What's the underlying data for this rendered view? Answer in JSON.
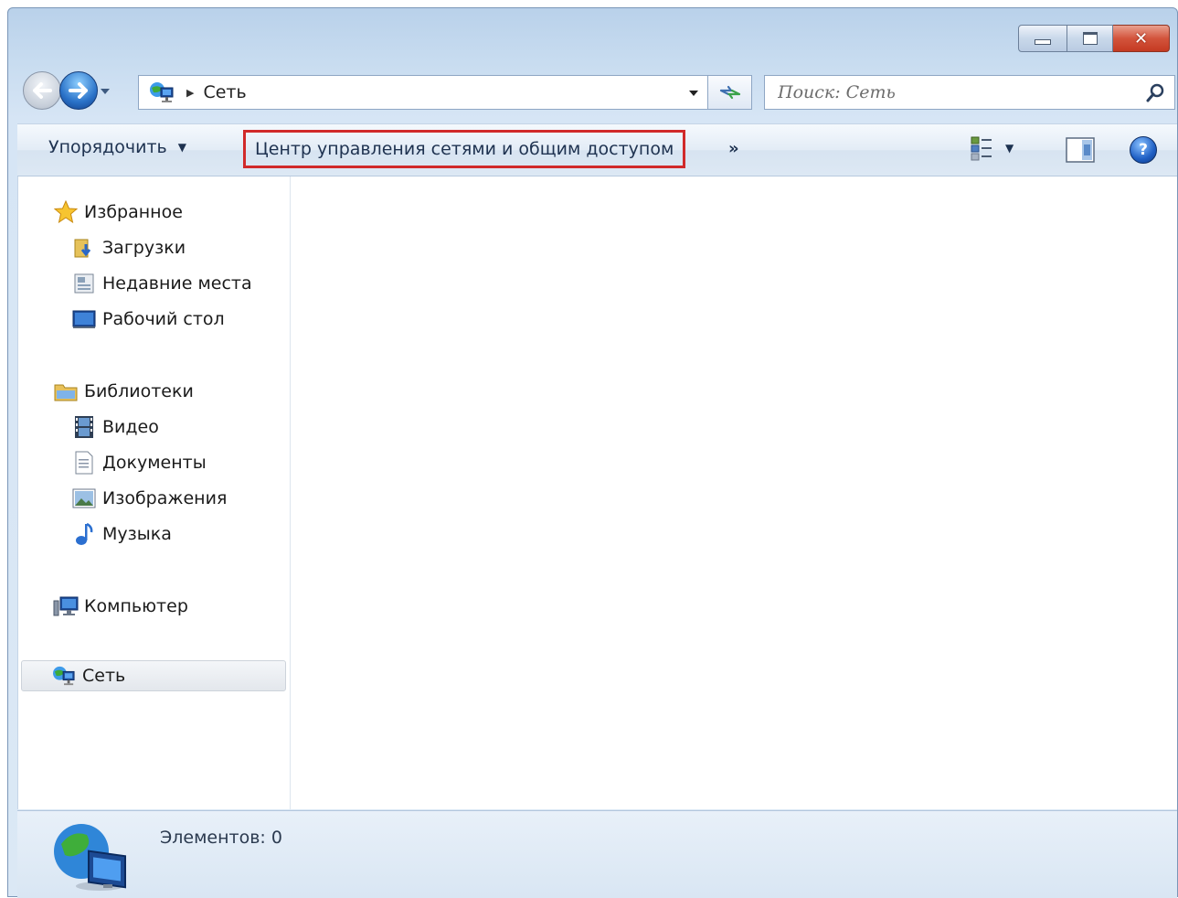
{
  "window": {
    "caption_buttons": [
      "minimize",
      "maximize",
      "close"
    ]
  },
  "address_bar": {
    "location_icon": "network-icon",
    "breadcrumb": [
      "Сеть"
    ]
  },
  "search": {
    "placeholder": "Поиск: Сеть"
  },
  "command_bar": {
    "organize_label": "Упорядочить",
    "network_center_label": "Центр управления сетями и общим доступом",
    "more_label": "»",
    "highlight_color": "#d12a2a"
  },
  "nav_pane": {
    "favorites": {
      "label": "Избранное",
      "items": [
        {
          "label": "Загрузки",
          "icon": "downloads-folder-icon"
        },
        {
          "label": "Недавние места",
          "icon": "recent-places-icon"
        },
        {
          "label": "Рабочий стол",
          "icon": "desktop-icon"
        }
      ]
    },
    "libraries": {
      "label": "Библиотеки",
      "items": [
        {
          "label": "Видео",
          "icon": "video-icon"
        },
        {
          "label": "Документы",
          "icon": "documents-icon"
        },
        {
          "label": "Изображения",
          "icon": "pictures-icon"
        },
        {
          "label": "Музыка",
          "icon": "music-icon"
        }
      ]
    },
    "computer": {
      "label": "Компьютер"
    },
    "network": {
      "label": "Сеть",
      "selected": true
    }
  },
  "status_bar": {
    "items_text": "Элементов: 0"
  }
}
